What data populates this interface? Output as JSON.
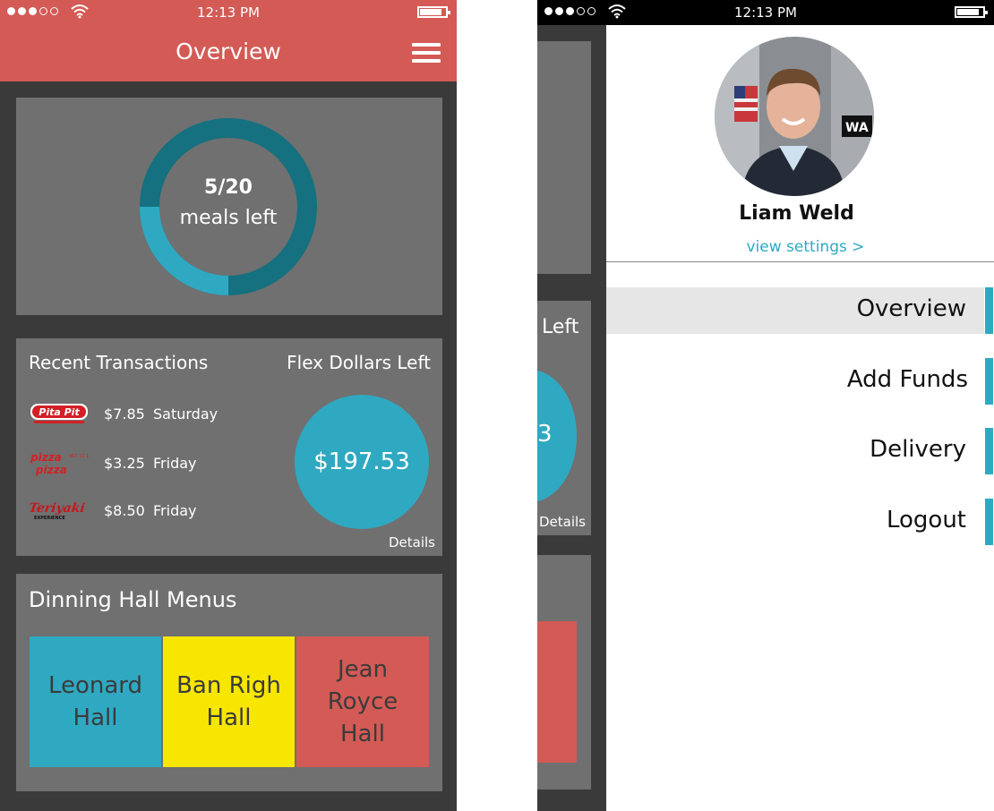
{
  "status": {
    "time": "12:13 PM"
  },
  "overview_screen": {
    "title": "Overview",
    "meals": {
      "count_text": "5/20",
      "label": "meals left",
      "fraction_used": 0.25
    },
    "transactions": {
      "heading": "Recent Transactions",
      "items": [
        {
          "vendor_logo": "Pita Pit",
          "amount": "$7.85",
          "day": "Saturday"
        },
        {
          "vendor_logo": "Pizza Pizza",
          "amount": "$3.25",
          "day": "Friday"
        },
        {
          "vendor_logo": "Teriyaki Experience",
          "amount": "$8.50",
          "day": "Friday"
        }
      ]
    },
    "flex": {
      "heading": "Flex Dollars Left",
      "amount": "$197.53",
      "details_label": "Details"
    },
    "dining": {
      "heading": "Dinning Hall Menus",
      "halls": [
        {
          "name": "Leonard Hall",
          "color": "#2fa9c2"
        },
        {
          "name": "Ban Righ Hall",
          "color": "#f7e600"
        },
        {
          "name": "Jean Royce Hall",
          "color": "#d45a55"
        }
      ]
    }
  },
  "menu_screen": {
    "underlay": {
      "heading_fragment": "Left",
      "amount_fragment": "3",
      "details_label": "Details"
    },
    "user": {
      "name": "Liam Weld",
      "settings_label": "view settings >"
    },
    "menu_items": [
      {
        "label": "Overview",
        "active": true
      },
      {
        "label": "Add Funds",
        "active": false
      },
      {
        "label": "Delivery",
        "active": false
      },
      {
        "label": "Logout",
        "active": false
      }
    ]
  },
  "colors": {
    "accent_red": "#d45a55",
    "accent_teal": "#2fa9c2",
    "accent_yellow": "#f7e600",
    "card_gray": "#707070",
    "background_dark": "#3a3a3a"
  },
  "icons": [
    "signal-dots-icon",
    "wifi-icon",
    "battery-icon",
    "hamburger-menu-icon",
    "chevron-right-icon"
  ]
}
